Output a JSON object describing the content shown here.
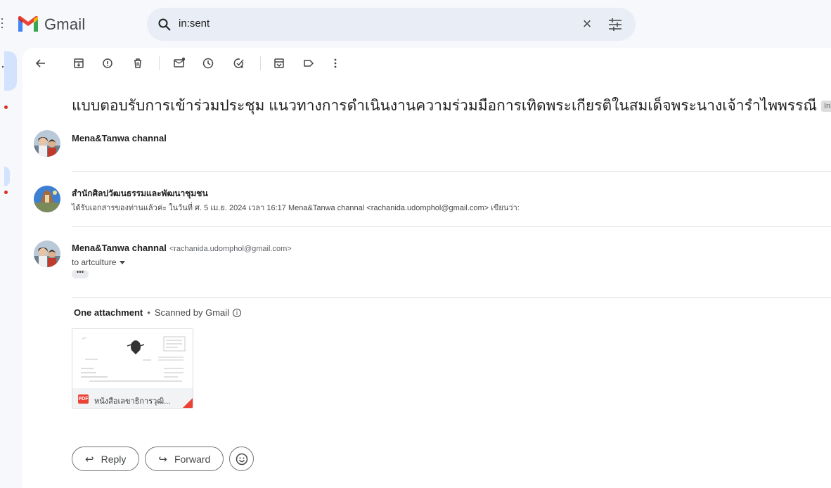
{
  "app": {
    "name": "Gmail"
  },
  "search": {
    "query": "in:sent",
    "icon": "search-icon"
  },
  "toolbar": {
    "icons": [
      "back-arrow-icon",
      "archive-icon",
      "report-spam-icon",
      "delete-icon",
      "mark-unread-icon",
      "snooze-icon",
      "add-task-icon",
      "move-to-icon",
      "label-icon",
      "more-vert-icon"
    ]
  },
  "thread": {
    "subject": "แบบตอบรับการเข้าร่วมประชุม แนวทางการดำเนินงานความร่วมมือการเทิดพระเกียรติในสมเด็จพระนางเจ้ารำไพพรรณี",
    "label": "Inbox",
    "label_remove": "×"
  },
  "messages": [
    {
      "sender": "Mena&Tanwa channal"
    },
    {
      "sender": "สำนักศิลปวัฒนธรรมและพัฒนาชุมชน",
      "snippet": "ได้รับเอกสารของท่านแล้วค่ะ ในวันที่ ศ. 5 เม.ย. 2024 เวลา 16:17 Mena&Tanwa channal <rachanida.udomphol@gmail.com> เขียนว่า:"
    },
    {
      "sender": "Mena&Tanwa channal",
      "email": "<rachanida.udomphol@gmail.com>",
      "to": "to artculture",
      "ellipsis": "•••"
    }
  ],
  "attachments": {
    "header_count": "One attachment",
    "separator": "•",
    "scanned": "Scanned by Gmail",
    "info_icon": "i",
    "file": {
      "type": "PDF",
      "name": "หนังสือเลขาธิการวุฒิ..."
    }
  },
  "actions": {
    "reply": "Reply",
    "forward": "Forward",
    "reply_icon": "↩",
    "forward_icon": "↪"
  },
  "colors": {
    "accent": "#0b57d0",
    "red": "#ea4335",
    "chip": "#dddddd"
  }
}
